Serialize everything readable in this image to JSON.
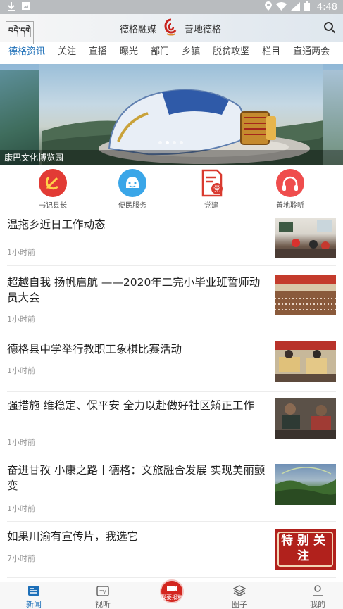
{
  "status_bar": {
    "time": "4:48",
    "icons": [
      "download-icon",
      "image-icon",
      "location-icon",
      "wifi-icon",
      "signal-icon",
      "battery-icon"
    ]
  },
  "header": {
    "tibetan_logo": "བདེ་དགེ",
    "brand_left": "德格融媒",
    "brand_right": "善地德格",
    "search_icon": "search-icon"
  },
  "tabs": [
    {
      "label": "德格资讯",
      "active": true
    },
    {
      "label": "关注"
    },
    {
      "label": "直播"
    },
    {
      "label": "曝光"
    },
    {
      "label": "部门"
    },
    {
      "label": "乡镇"
    },
    {
      "label": "脱贫攻坚"
    },
    {
      "label": "栏目"
    },
    {
      "label": "直通两会"
    }
  ],
  "banner": {
    "caption": "康巴文化博览园",
    "slide_index": 1,
    "slide_count": 4
  },
  "shortcuts": [
    {
      "label": "书记县长",
      "icon": "party-emblem-icon",
      "color": "#e23b35"
    },
    {
      "label": "便民服务",
      "icon": "smiley-icon",
      "color": "#3aa6e8"
    },
    {
      "label": "党建",
      "icon": "party-building-icon",
      "color": "#d93a2f"
    },
    {
      "label": "善地聆听",
      "icon": "headphones-icon",
      "color": "#ef4d4d"
    }
  ],
  "news": [
    {
      "title": "温拖乡近日工作动态",
      "time": "1小时前",
      "thumb": "classroom-photo"
    },
    {
      "title": "超越自我 扬帆启航 ——2020年二完小毕业班誓师动员大会",
      "time": "1小时前",
      "thumb": "assembly-photo"
    },
    {
      "title": "德格县中学举行教职工象棋比赛活动",
      "time": "1小时前",
      "thumb": "chess-photo"
    },
    {
      "title": "强措施 维稳定、保平安 全力以赴做好社区矫正工作",
      "time": "1小时前",
      "thumb": "meeting-photo"
    },
    {
      "title": "奋进甘孜 小康之路丨德格：文旅融合发展 实现美丽颤变",
      "time": "1小时前",
      "thumb": "landscape-photo"
    },
    {
      "title": "如果川渝有宣传片，我选它",
      "time": "7小时前",
      "thumb": "special-focus-photo",
      "thumb_text": "特别关注"
    }
  ],
  "bottom_nav": [
    {
      "label": "新闻",
      "icon": "news-icon",
      "active": true
    },
    {
      "label": "视听",
      "icon": "tv-icon"
    },
    {
      "label": "我要报料",
      "icon": "camera-icon"
    },
    {
      "label": "圈子",
      "icon": "layers-icon"
    },
    {
      "label": "我的",
      "icon": "user-icon"
    }
  ],
  "colors": {
    "accent": "#1d6fb8",
    "brand_red": "#d3261f",
    "status_bar": "#b9bcbf"
  }
}
